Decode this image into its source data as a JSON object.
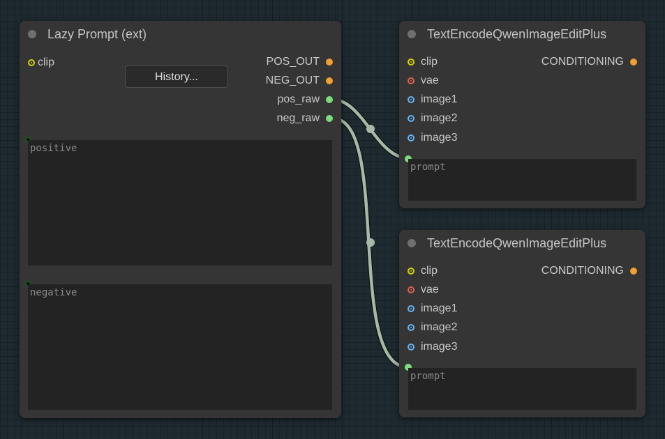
{
  "nodes": {
    "lazy_prompt": {
      "title": "Lazy Prompt (ext)",
      "inputs": [
        {
          "label": "clip",
          "color": "#d4d400"
        }
      ],
      "outputs": [
        {
          "label": "POS_OUT",
          "color": "#f0a030"
        },
        {
          "label": "NEG_OUT",
          "color": "#f0a030"
        },
        {
          "label": "pos_raw",
          "color": "#7ddc7d"
        },
        {
          "label": "neg_raw",
          "color": "#7ddc7d"
        }
      ],
      "history_button": "History...",
      "positive_placeholder": "positive",
      "negative_placeholder": "negative"
    },
    "encode_top": {
      "title": "TextEncodeQwenImageEditPlus",
      "inputs": [
        {
          "label": "clip",
          "color": "#d4d400"
        },
        {
          "label": "vae",
          "color": "#e0604e"
        },
        {
          "label": "image1",
          "color": "#64b5f6"
        },
        {
          "label": "image2",
          "color": "#64b5f6"
        },
        {
          "label": "image3",
          "color": "#64b5f6"
        }
      ],
      "outputs": [
        {
          "label": "CONDITIONING",
          "color": "#f0a030"
        }
      ],
      "prompt_placeholder": "prompt"
    },
    "encode_bottom": {
      "title": "TextEncodeQwenImageEditPlus",
      "inputs": [
        {
          "label": "clip",
          "color": "#d4d400"
        },
        {
          "label": "vae",
          "color": "#e0604e"
        },
        {
          "label": "image1",
          "color": "#64b5f6"
        },
        {
          "label": "image2",
          "color": "#64b5f6"
        },
        {
          "label": "image3",
          "color": "#64b5f6"
        }
      ],
      "outputs": [
        {
          "label": "CONDITIONING",
          "color": "#f0a030"
        }
      ],
      "prompt_placeholder": "prompt"
    }
  },
  "colors": {
    "canvas": "#1e2a30",
    "node_bg": "#353535",
    "link": "#a7b8a7",
    "string_socket": "#7ddc7d"
  }
}
